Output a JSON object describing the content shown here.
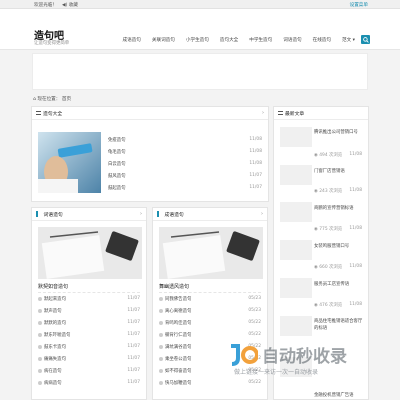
{
  "topbar": {
    "welcome": "欢迎光临！",
    "speaker": "◀) 收藏",
    "right_link": "设置菜单"
  },
  "header": {
    "site_name": "造句吧",
    "slogan": "让造句变得更简单"
  },
  "nav": {
    "items": [
      "成语造句",
      "关联词造句",
      "小学生造句",
      "造句大全",
      "中学生造句",
      "词语造句",
      "在线造句",
      "范文 ▾"
    ]
  },
  "breadcrumb": {
    "home_icon": "home-icon",
    "position": "现在位置：",
    "current": "首页"
  },
  "section_main": {
    "title": "造句大全",
    "more": "›",
    "items": [
      {
        "title": "免疫造句",
        "date": "11/08"
      },
      {
        "title": "龟毛造句",
        "date": "11/08"
      },
      {
        "title": "白云造句",
        "date": "11/08"
      },
      {
        "title": "鼓风造句",
        "date": "11/07"
      },
      {
        "title": "鼓起造句",
        "date": "11/07"
      }
    ]
  },
  "section_left": {
    "title": "词语造句",
    "more": "›",
    "headline": "默契如音造句",
    "items": [
      {
        "title": "默起来造句",
        "date": "11/07"
      },
      {
        "title": "默声造句",
        "date": "11/07"
      },
      {
        "title": "默默的造句",
        "date": "11/07"
      },
      {
        "title": "默东吓唬造句",
        "date": "11/07"
      },
      {
        "title": "鼓东卡造句",
        "date": "11/07"
      },
      {
        "title": "痛痛失造句",
        "date": "11/07"
      },
      {
        "title": "病在造句",
        "date": "11/07"
      },
      {
        "title": "病病造句",
        "date": "11/07"
      }
    ]
  },
  "section_mid": {
    "title": "成语造句",
    "more": "›",
    "headline": "舞幽透风造句",
    "items": [
      {
        "title": "同我佛告造句",
        "date": "05/23"
      },
      {
        "title": "离心离德造句",
        "date": "05/23"
      },
      {
        "title": "背鸣鸣佳造句",
        "date": "05/22"
      },
      {
        "title": "躺背行仁造句",
        "date": "05/22"
      },
      {
        "title": "满坑满谷造句",
        "date": "05/22"
      },
      {
        "title": "乘坐卷公造句",
        "date": "05/22"
      },
      {
        "title": "如不得奋造句",
        "date": "05/22"
      },
      {
        "title": "快马加鞭造句",
        "date": "05/22"
      }
    ]
  },
  "sidebar": {
    "title": "最新文章",
    "articles": [
      {
        "title": "腾讯推出公司营销口号",
        "views": "494 次浏览",
        "date": "11/08"
      },
      {
        "title": "门窗厂店营销语",
        "views": "243 次浏览",
        "date": "11/08"
      },
      {
        "title": "商鹏的宣传营销标语",
        "views": "775 次浏览",
        "date": "11/08"
      },
      {
        "title": "女装鸣服营销口号",
        "views": "660 次浏览",
        "date": "11/08"
      },
      {
        "title": "服务员工店宣传语",
        "views": "476 次浏览",
        "date": "11/08"
      },
      {
        "title": "商品住宅推销语适合客厅的标语",
        "views": "",
        "date": ""
      },
      {
        "title": "金融投机营销广告语",
        "views": "",
        "date": ""
      }
    ]
  },
  "watermark": {
    "brand": "自动秒收录",
    "tagline": "做上链接一来访一次一自动收录"
  },
  "colors": {
    "accent": "#1b8fb0",
    "page_bg": "#f3f3f3",
    "panel_bg": "#ffffff"
  }
}
